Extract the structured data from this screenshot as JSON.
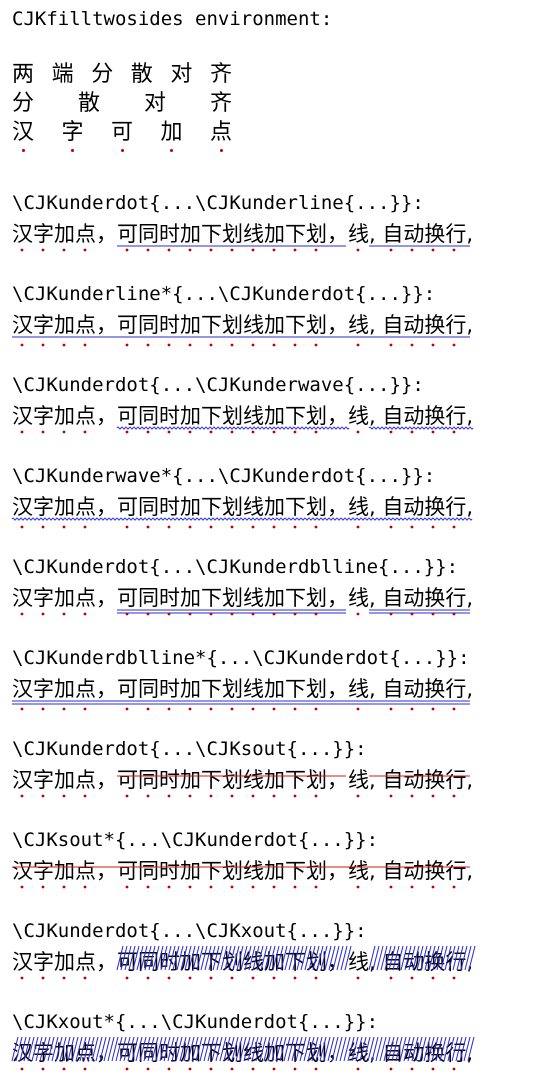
{
  "title": "CJKfilltwosides environment:",
  "filltwosides": {
    "lines": [
      "两端分散对齐",
      "分散对齐",
      "汉字可加点"
    ]
  },
  "sample_text": "汉字加点，可同时加下划线加下划，线, 自动换行,",
  "sections": [
    {
      "command": "\\CJKunderdot{...\\CJKunderline{...}}:"
    },
    {
      "command": "\\CJKunderline*{...\\CJKunderdot{...}}:"
    },
    {
      "command": "\\CJKunderdot{...\\CJKunderwave{...}}:"
    },
    {
      "command": "\\CJKunderwave*{...\\CJKunderdot{...}}:"
    },
    {
      "command": "\\CJKunderdot{...\\CJKunderdblline{...}}:"
    },
    {
      "command": "\\CJKunderdblline*{...\\CJKunderdot{...}}:"
    },
    {
      "command": "\\CJKunderdot{...\\CJKsout{...}}:"
    },
    {
      "command": "\\CJKsout*{...\\CJKunderdot{...}}:"
    },
    {
      "command": "\\CJKunderdot{...\\CJKxout{...}}:"
    },
    {
      "command": "\\CJKxout*{...\\CJKunderdot{...}}:"
    }
  ],
  "colors": {
    "text": "#000000",
    "dot": "#c00000",
    "underline": "#2b2bd4",
    "sout": "#d21a1a",
    "xout": "#2b2bd4"
  }
}
